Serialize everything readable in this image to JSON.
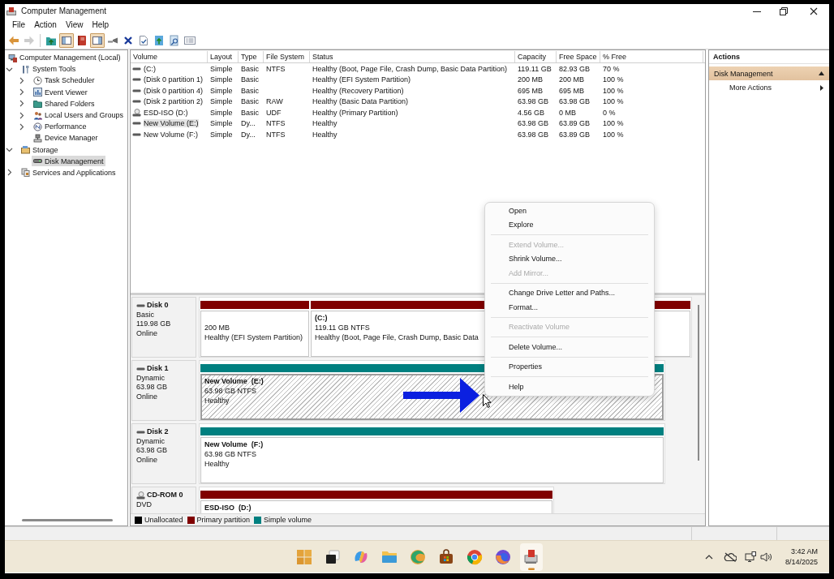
{
  "window": {
    "title": "Computer Management"
  },
  "menu_bar": [
    "File",
    "Action",
    "View",
    "Help"
  ],
  "toolbar": [
    [
      {
        "kind": "back",
        "pressed": false,
        "disabled": false
      },
      {
        "kind": "forward",
        "pressed": false,
        "disabled": true
      }
    ],
    [
      {
        "kind": "up",
        "pressed": false,
        "disabled": false
      },
      {
        "kind": "console_tree",
        "pressed": true,
        "disabled": false
      },
      {
        "kind": "help",
        "pressed": false,
        "disabled": false
      },
      {
        "kind": "action_pane",
        "pressed": true,
        "disabled": false
      },
      {
        "kind": "connect",
        "pressed": false,
        "disabled": false
      },
      {
        "kind": "delete",
        "pressed": false,
        "disabled": false
      },
      {
        "kind": "properties",
        "pressed": false,
        "disabled": false
      },
      {
        "kind": "export",
        "pressed": false,
        "disabled": false
      },
      {
        "kind": "help_topics",
        "pressed": false,
        "disabled": false
      },
      {
        "kind": "list",
        "pressed": false,
        "disabled": false
      }
    ]
  ],
  "tree": [
    {
      "label": "Computer Management (Local)",
      "selected": false,
      "children": [
        {
          "label": "System Tools",
          "expanded": true,
          "selected": false,
          "children": [
            {
              "label": "Task Scheduler",
              "expanded": false,
              "selected": false
            },
            {
              "label": "Event Viewer",
              "expanded": false,
              "selected": false
            },
            {
              "label": "Shared Folders",
              "expanded": false,
              "selected": false
            },
            {
              "label": "Local Users and Groups",
              "expanded": false,
              "selected": false
            },
            {
              "label": "Performance",
              "expanded": false,
              "selected": false
            },
            {
              "label": "Device Manager",
              "selected": false
            }
          ]
        },
        {
          "label": "Storage",
          "expanded": true,
          "selected": false,
          "children": [
            {
              "label": "Disk Management",
              "selected": true
            }
          ]
        },
        {
          "label": "Services and Applications",
          "expanded": false,
          "selected": false
        }
      ]
    }
  ],
  "volume_table": {
    "columns": [
      "Volume",
      "Layout",
      "Type",
      "File System",
      "Status",
      "Capacity",
      "Free Space",
      "% Free"
    ],
    "rows": [
      {
        "kind": "disk",
        "selected": false,
        "volume": "(C:)",
        "layout": "Simple",
        "type": "Basic",
        "file_system": "NTFS",
        "status": "Healthy (Boot, Page File, Crash Dump, Basic Data Partition)",
        "capacity": "119.11 GB",
        "free_space": "82.93 GB",
        "percent_free": "70 %"
      },
      {
        "kind": "disk",
        "selected": false,
        "volume": "(Disk 0 partition 1)",
        "layout": "Simple",
        "type": "Basic",
        "status": "Healthy (EFI System Partition)",
        "capacity": "200 MB",
        "free_space": "200 MB",
        "percent_free": "100 %"
      },
      {
        "kind": "disk",
        "selected": false,
        "volume": "(Disk 0 partition 4)",
        "layout": "Simple",
        "type": "Basic",
        "status": "Healthy (Recovery Partition)",
        "capacity": "695 MB",
        "free_space": "695 MB",
        "percent_free": "100 %"
      },
      {
        "kind": "disk",
        "selected": false,
        "volume": "(Disk 2 partition 2)",
        "layout": "Simple",
        "type": "Basic",
        "file_system": "RAW",
        "status": "Healthy (Basic Data Partition)",
        "capacity": "63.98 GB",
        "free_space": "63.98 GB",
        "percent_free": "100 %"
      },
      {
        "kind": "cd",
        "selected": false,
        "volume": "ESD-ISO (D:)",
        "layout": "Simple",
        "type": "Basic",
        "file_system": "UDF",
        "status": "Healthy (Primary Partition)",
        "capacity": "4.56 GB",
        "free_space": "0 MB",
        "percent_free": "0 %"
      },
      {
        "kind": "disk",
        "selected": true,
        "volume": "New Volume (E:)",
        "layout": "Simple",
        "type": "Dy...",
        "file_system": "NTFS",
        "status": "Healthy",
        "capacity": "63.98 GB",
        "free_space": "63.89 GB",
        "percent_free": "100 %"
      },
      {
        "kind": "disk",
        "selected": false,
        "volume": "New Volume (F:)",
        "layout": "Simple",
        "type": "Dy...",
        "file_system": "NTFS",
        "status": "Healthy",
        "capacity": "63.98 GB",
        "free_space": "63.89 GB",
        "percent_free": "100 %"
      }
    ]
  },
  "disks": [
    {
      "kind": "disk",
      "name": "Disk 0",
      "lines": [
        "Basic",
        "119.98 GB",
        "Online"
      ],
      "partitions": [
        {
          "color": "#800000",
          "selected": false,
          "lines": [
            "200 MB",
            "Healthy (EFI System Partition)"
          ]
        },
        {
          "color": "#800000",
          "selected": false,
          "title": "(C:)",
          "lines": [
            "119.11 GB NTFS",
            "Healthy (Boot, Page File, Crash Dump, Basic Data"
          ]
        }
      ]
    },
    {
      "kind": "disk",
      "name": "Disk 1",
      "lines": [
        "Dynamic",
        "63.98 GB",
        "Online"
      ],
      "partitions": [
        {
          "color": "#008080",
          "selected": true,
          "title": "New Volume  (E:)",
          "lines": [
            "63.98 GB NTFS",
            "Healthy"
          ]
        }
      ]
    },
    {
      "kind": "disk",
      "name": "Disk 2",
      "lines": [
        "Dynamic",
        "63.98 GB",
        "Online"
      ],
      "partitions": [
        {
          "color": "#008080",
          "selected": false,
          "title": "New Volume  (F:)",
          "lines": [
            "63.98 GB NTFS",
            "Healthy"
          ]
        }
      ]
    },
    {
      "kind": "cd",
      "name": "CD-ROM 0",
      "lines": [
        "DVD"
      ],
      "partitions": [
        {
          "color": "#800000",
          "selected": false,
          "title": "ESD-ISO  (D:)"
        }
      ]
    }
  ],
  "legend": [
    {
      "label": "Unallocated",
      "color": "#000000"
    },
    {
      "label": "Primary partition",
      "color": "#800000"
    },
    {
      "label": "Simple volume",
      "color": "#008080"
    }
  ],
  "actions": {
    "title": "Actions",
    "sections": [
      {
        "title": "Disk Management",
        "expanded": true,
        "items": [
          {
            "label": "More Actions",
            "submenu": true
          }
        ]
      }
    ]
  },
  "context_menu": {
    "items": [
      {
        "kind": "item",
        "label": "Open",
        "disabled": false
      },
      {
        "kind": "item",
        "label": "Explore",
        "disabled": false
      },
      {
        "kind": "separator"
      },
      {
        "kind": "item",
        "label": "Extend Volume...",
        "disabled": true
      },
      {
        "kind": "item",
        "label": "Shrink Volume...",
        "disabled": false
      },
      {
        "kind": "item",
        "label": "Add Mirror...",
        "disabled": true
      },
      {
        "kind": "separator"
      },
      {
        "kind": "item",
        "label": "Change Drive Letter and Paths...",
        "disabled": false
      },
      {
        "kind": "item",
        "label": "Format...",
        "disabled": false
      },
      {
        "kind": "separator"
      },
      {
        "kind": "item",
        "label": "Reactivate Volume",
        "disabled": true
      },
      {
        "kind": "separator"
      },
      {
        "kind": "item",
        "label": "Delete Volume...",
        "disabled": false
      },
      {
        "kind": "separator"
      },
      {
        "kind": "item",
        "label": "Properties",
        "disabled": false
      },
      {
        "kind": "separator"
      },
      {
        "kind": "item",
        "label": "Help",
        "disabled": false
      }
    ]
  },
  "taskbar": {
    "apps": [
      {
        "kind": "start",
        "active": false
      },
      {
        "kind": "task_view",
        "active": false
      },
      {
        "kind": "copilot",
        "active": false
      },
      {
        "kind": "file_explorer",
        "active": false
      },
      {
        "kind": "edge",
        "active": false
      },
      {
        "kind": "store",
        "active": false
      },
      {
        "kind": "chrome",
        "active": false
      },
      {
        "kind": "firefox",
        "active": false
      },
      {
        "kind": "computer_management",
        "active": true
      }
    ],
    "clock": {
      "time": "3:42 AM",
      "date": "8/14/2025"
    }
  }
}
